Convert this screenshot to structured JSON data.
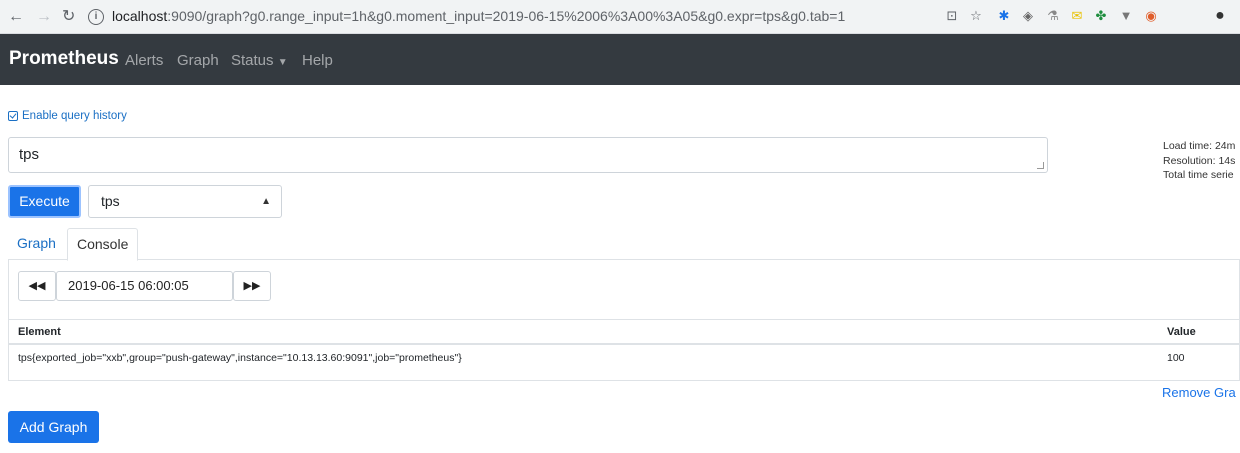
{
  "browser": {
    "url_host": "localhost",
    "url_rest": ":9090/graph?g0.range_input=1h&g0.moment_input=2019-06-15%2006%3A00%3A05&g0.expr=tps&g0.tab=1"
  },
  "navbar": {
    "brand": "Prometheus",
    "links": [
      "Alerts",
      "Graph",
      "Status",
      "Help"
    ]
  },
  "query_history_label": "Enable query history",
  "expression": "tps",
  "stats": {
    "load_time": "Load time: 24m",
    "resolution": "Resolution: 14s",
    "total_series": "Total time serie"
  },
  "execute_label": "Execute",
  "metric_select": "tps",
  "tabs": {
    "graph": "Graph",
    "console": "Console"
  },
  "console": {
    "moment": "2019-06-15 06:00:05",
    "headers": {
      "element": "Element",
      "value": "Value"
    },
    "rows": [
      {
        "element": "tps{exported_job=\"xxb\",group=\"push-gateway\",instance=\"10.13.13.60:9091\",job=\"prometheus\"}",
        "value": "100"
      }
    ]
  },
  "remove_graph": "Remove Gra",
  "add_graph": "Add Graph",
  "colors": {
    "navbar": "#343a40",
    "primary": "#1a73e8",
    "link": "#1a6fc4"
  }
}
